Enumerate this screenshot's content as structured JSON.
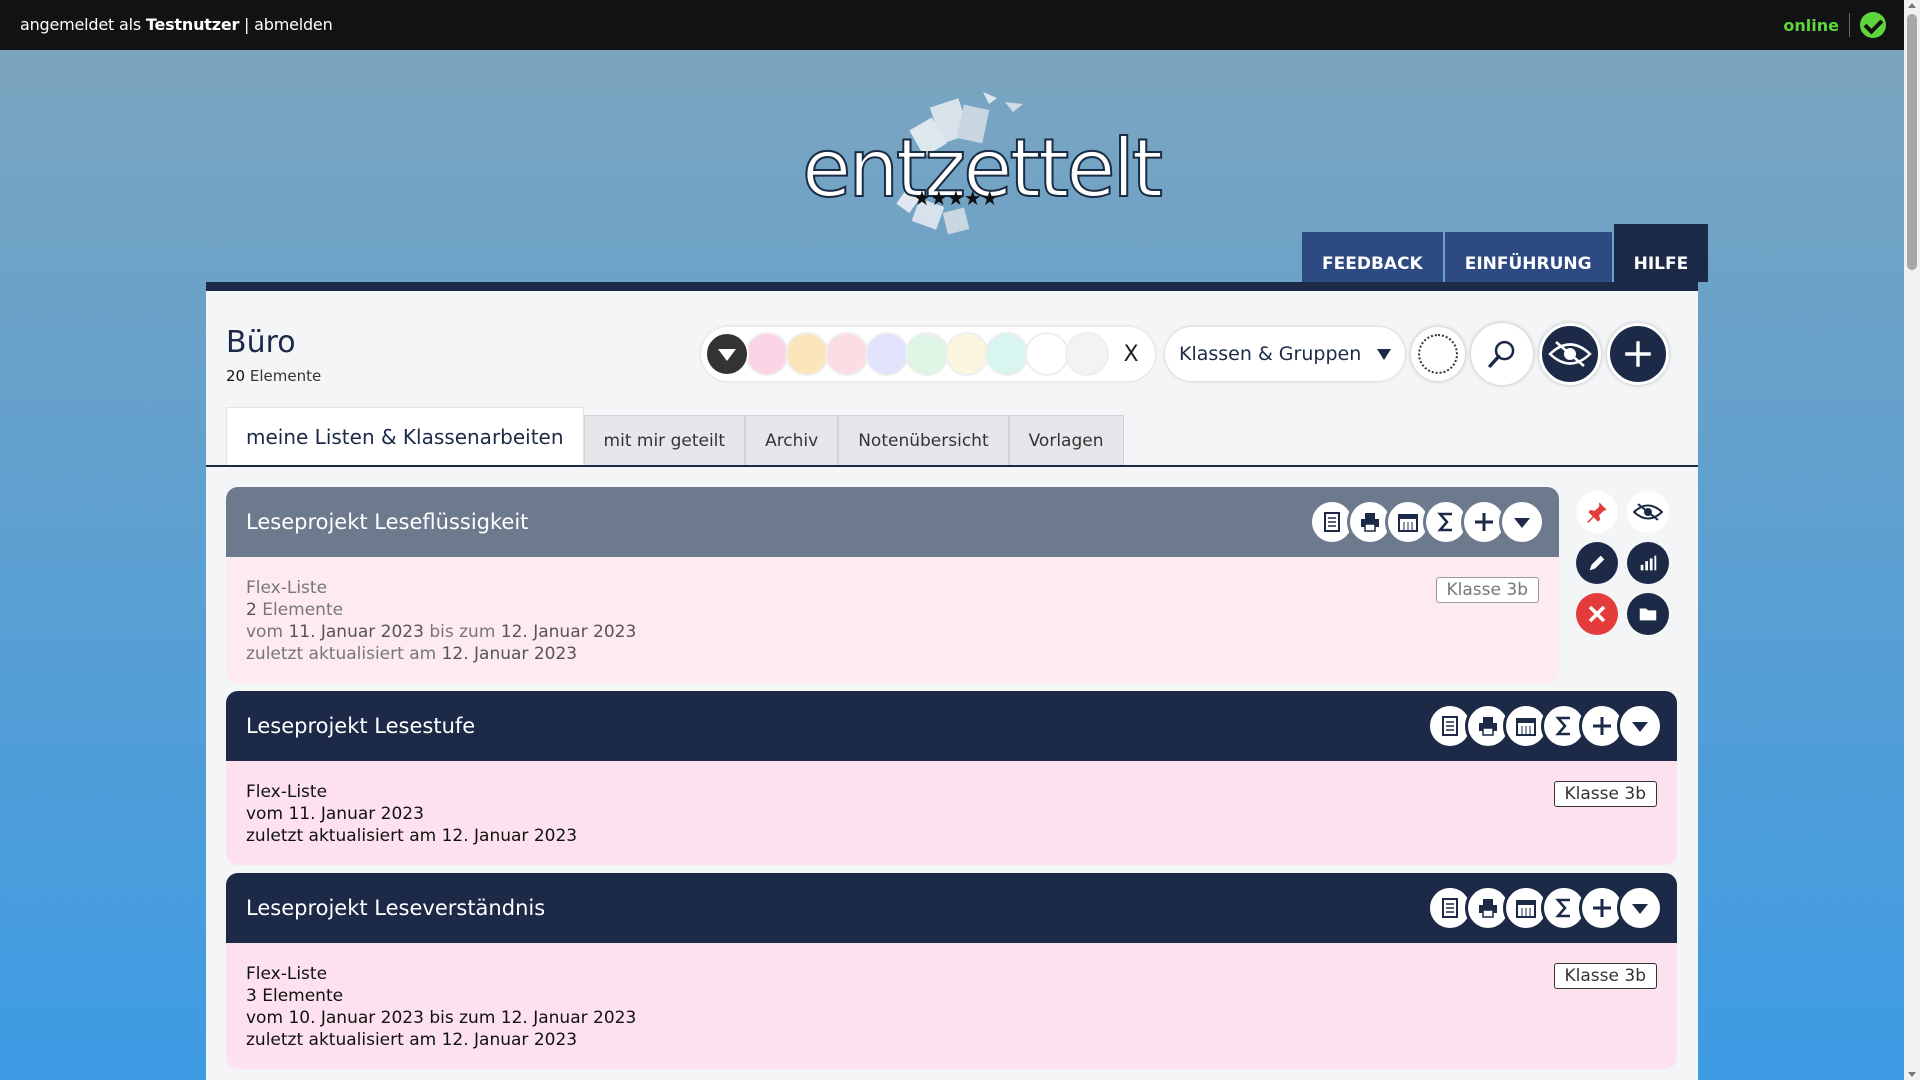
{
  "topbar": {
    "prefix": "angemeldet als ",
    "username": "Testnutzer",
    "separator": " | ",
    "logout": "abmelden",
    "status": "online"
  },
  "logo": {
    "brand": "entzettelt",
    "stars": "★★★★★"
  },
  "nav": [
    {
      "label": "FEEDBACK"
    },
    {
      "label": "EINFÜHRUNG"
    },
    {
      "label": "HILFE"
    }
  ],
  "panel": {
    "title": "Büro",
    "count": "20",
    "count_label": " Elemente"
  },
  "toolbar": {
    "swatches": [
      "#fbd5e6",
      "#fbe5bb",
      "#fbdde3",
      "#e0e3fb",
      "#dff5e6",
      "#fbf5df",
      "#d8f5ef",
      "#ffffff",
      "#f3f3f3"
    ],
    "clear": "X",
    "dropdown": "Klassen & Gruppen"
  },
  "tabs": [
    {
      "label": "meine Listen & Klassenarbeiten"
    },
    {
      "label": "mit mir geteilt"
    },
    {
      "label": "Archiv"
    },
    {
      "label": "Notenübersicht"
    },
    {
      "label": "Vorlagen"
    }
  ],
  "cards": [
    {
      "title": "Leseprojekt Leseflüssigkeit",
      "type": "Flex-Liste",
      "count": "2",
      "count_label": " Elemente",
      "from_prefix": "vom ",
      "from": "11. Januar 2023",
      "to_prefix": " bis zum ",
      "to": "12. Januar 2023",
      "updated_prefix": "zuletzt aktualisiert am ",
      "updated": "12. Januar 2023",
      "tag": "Klasse 3b"
    },
    {
      "title": "Leseprojekt Lesestufe",
      "type": "Flex-Liste",
      "from_prefix": "vom ",
      "from": "11. Januar 2023",
      "updated_prefix": "zuletzt aktualisiert am ",
      "updated": "12. Januar 2023",
      "tag": "Klasse 3b"
    },
    {
      "title": "Leseprojekt Leseverständnis",
      "type": "Flex-Liste",
      "count": "3",
      "count_label": " Elemente",
      "from_prefix": "vom ",
      "from": "10. Januar 2023",
      "to_prefix": " bis zum ",
      "to": "12. Januar 2023",
      "updated_prefix": "zuletzt aktualisiert am ",
      "updated": "12. Januar 2023",
      "tag": "Klasse 3b"
    }
  ],
  "head_icons": [
    "document-icon",
    "printer-icon",
    "calendar-icon",
    "sigma-icon",
    "plus-icon",
    "chevron-down-icon"
  ],
  "side_actions": [
    "pin-icon",
    "eye-slash-icon",
    "pencil-icon",
    "chart-icon",
    "delete-icon",
    "folder-icon"
  ]
}
